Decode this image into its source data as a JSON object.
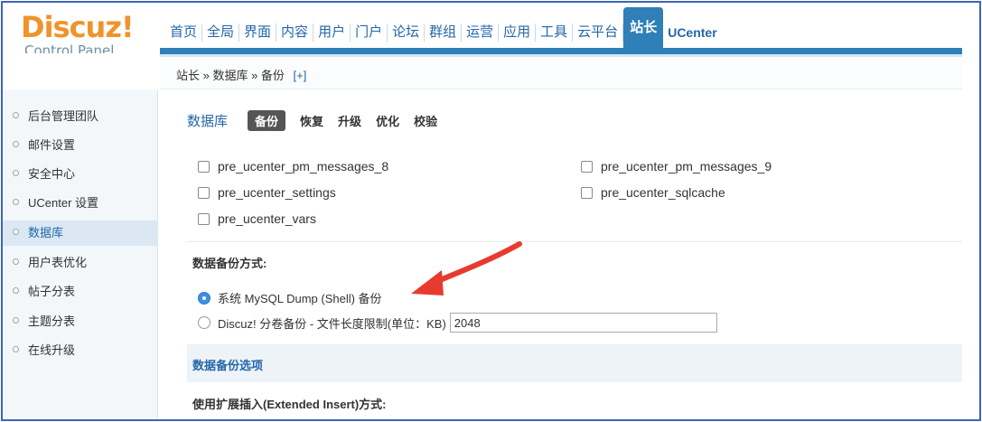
{
  "logo": {
    "main": "Discuz!",
    "sub": "Control Panel"
  },
  "topnav": [
    {
      "label": "首页"
    },
    {
      "label": "全局"
    },
    {
      "label": "界面"
    },
    {
      "label": "内容"
    },
    {
      "label": "用户"
    },
    {
      "label": "门户"
    },
    {
      "label": "论坛"
    },
    {
      "label": "群组"
    },
    {
      "label": "运营"
    },
    {
      "label": "应用"
    },
    {
      "label": "工具"
    },
    {
      "label": "云平台"
    },
    {
      "label": "站长",
      "active": true
    },
    {
      "label": "UCenter"
    }
  ],
  "breadcrumb": {
    "text": "站长 » 数据库 » 备份",
    "plus": "[+]"
  },
  "sidebar": {
    "items": [
      {
        "label": "后台管理团队"
      },
      {
        "label": "邮件设置"
      },
      {
        "label": "安全中心"
      },
      {
        "label": "UCenter 设置"
      },
      {
        "label": "数据库",
        "active": true
      },
      {
        "label": "用户表优化"
      },
      {
        "label": "帖子分表"
      },
      {
        "label": "主题分表"
      },
      {
        "label": "在线升级"
      }
    ]
  },
  "main": {
    "title": "数据库",
    "tabs": [
      {
        "label": "备份",
        "active": true
      },
      {
        "label": "恢复"
      },
      {
        "label": "升级"
      },
      {
        "label": "优化"
      },
      {
        "label": "校验"
      }
    ],
    "tables": [
      "pre_ucenter_pm_messages_8",
      "pre_ucenter_pm_messages_9",
      "pre_ucenter_settings",
      "pre_ucenter_sqlcache",
      "pre_ucenter_vars"
    ],
    "backup_method_label": "数据备份方式:",
    "methods": [
      {
        "label": "系统 MySQL Dump (Shell) 备份",
        "checked": true
      },
      {
        "label": "Discuz! 分卷备份 - 文件长度限制(单位：KB)",
        "checked": false,
        "value": "2048"
      }
    ],
    "options_title": "数据备份选项",
    "extended_insert_label": "使用扩展插入(Extended Insert)方式:"
  },
  "colors": {
    "accent": "#2f7fb8",
    "link": "#2367a8",
    "logo": "#f0932b",
    "annotation_arrow": "#e83a2f"
  }
}
